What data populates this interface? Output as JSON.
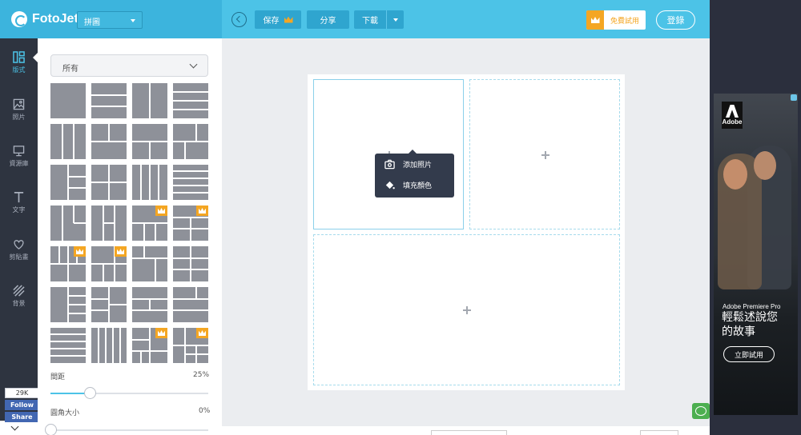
{
  "app": {
    "name": "FotoJet"
  },
  "header": {
    "mode": "拼圖",
    "save_label": "保存",
    "share_label": "分享",
    "download_label": "下載",
    "trial_label": "免費試用",
    "login_label": "登錄"
  },
  "rail": {
    "items": [
      {
        "label": "版式",
        "icon": "layout-icon",
        "active": true
      },
      {
        "label": "照片",
        "icon": "image-icon"
      },
      {
        "label": "資源庫",
        "icon": "monitor-icon"
      },
      {
        "label": "文字",
        "icon": "text-icon"
      },
      {
        "label": "剪貼畫",
        "icon": "heart-icon"
      },
      {
        "label": "背景",
        "icon": "background-icon"
      }
    ]
  },
  "facebook": {
    "count": "29K",
    "follow_label": "Follow",
    "share_label": "Share"
  },
  "panel": {
    "filter_value": "所有",
    "templates_premium": [
      false,
      false,
      false,
      false,
      false,
      false,
      false,
      false,
      false,
      false,
      false,
      false,
      false,
      false,
      true,
      true,
      true,
      true,
      false,
      false,
      false,
      false,
      false,
      false,
      false,
      false,
      true,
      true
    ],
    "spacing": {
      "label": "間距",
      "value": "25%",
      "fraction": 0.25
    },
    "radius": {
      "label": "圓角大小",
      "value": "0%",
      "fraction": 0
    }
  },
  "popup": {
    "add_photo_label": "添加照片",
    "fill_color_label": "填充顏色"
  },
  "ad": {
    "brand": "Adobe",
    "product": "Adobe Premiere Pro",
    "headline_line1": "輕鬆述說您",
    "headline_line2": "的故事",
    "cta_label": "立即試用"
  },
  "colors": {
    "accent": "#4cc3e7",
    "premium": "#f4a623",
    "sidebar": "#2e3440",
    "popup": "#333b4c"
  }
}
